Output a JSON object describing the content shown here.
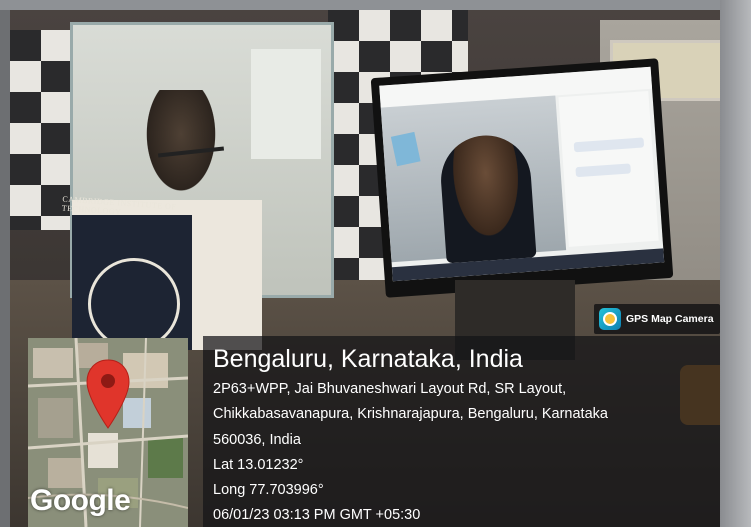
{
  "scene": {
    "podium_text": "CAMBRIDGE INSTITUTE OF TECHNOLOGY",
    "wall_logo_text": "CAMBRIDGE"
  },
  "overlay": {
    "app_badge": {
      "icon": "gps-map-camera-icon",
      "label": "GPS Map Camera"
    },
    "location_title": "Bengaluru, Karnataka, India",
    "address_lines": [
      "2P63+WPP, Jai Bhuvaneshwari Layout Rd, SR Layout,",
      "Chikkabasavanapura, Krishnarajapura, Bengaluru, Karnataka",
      "560036, India"
    ],
    "latitude": "Lat 13.01232°",
    "longitude": "Long 77.703996°",
    "timestamp": "06/01/23 03:13 PM GMT +05:30",
    "map_attribution": "Google",
    "pin_icon": "map-pin-icon",
    "pin_color": "#e0352b"
  }
}
